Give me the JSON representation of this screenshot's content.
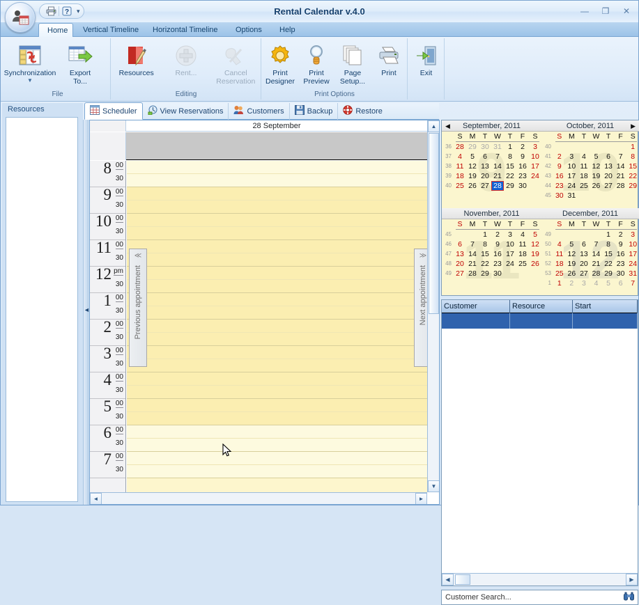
{
  "window": {
    "title": "Rental Calendar v.4.0",
    "minimize": "—",
    "maximize": "❐",
    "close": "✕"
  },
  "quick_access": {
    "print_tooltip": "Print",
    "help_tooltip": "Help",
    "dropdown": "▾"
  },
  "ribbon": {
    "tabs": [
      {
        "label": "Home",
        "active": true
      },
      {
        "label": "Vertical Timeline",
        "active": false
      },
      {
        "label": "Horizontal Timeline",
        "active": false
      },
      {
        "label": "Options",
        "active": false
      },
      {
        "label": "Help",
        "active": false
      }
    ],
    "groups": [
      {
        "name": "File",
        "label": "File",
        "items": [
          {
            "label": "Synchronization",
            "icon": "synchronization-icon",
            "dropdown": true,
            "disabled": false
          },
          {
            "label": "Export\nTo...",
            "icon": "export-icon",
            "dropdown": true,
            "disabled": false
          }
        ]
      },
      {
        "name": "Editing",
        "label": "Editing",
        "items": [
          {
            "label": "Resources",
            "icon": "resources-icon",
            "dropdown": false,
            "disabled": false
          },
          {
            "label": "Rent...",
            "icon": "plus-icon",
            "dropdown": false,
            "disabled": true
          },
          {
            "label": "Cancel\nReservation",
            "icon": "cancel-icon",
            "dropdown": true,
            "disabled": true
          }
        ]
      },
      {
        "name": "PrintOptions",
        "label": "Print Options",
        "items": [
          {
            "label": "Print\nDesigner",
            "icon": "gear-icon",
            "dropdown": false,
            "disabled": false
          },
          {
            "label": "Print\nPreview",
            "icon": "magnifier-icon",
            "dropdown": false,
            "disabled": false
          },
          {
            "label": "Page\nSetup...",
            "icon": "pages-icon",
            "dropdown": false,
            "disabled": false
          },
          {
            "label": "Print",
            "icon": "printer-icon",
            "dropdown": false,
            "disabled": false
          }
        ]
      },
      {
        "name": "Exit",
        "label": "",
        "items": [
          {
            "label": "Exit",
            "icon": "exit-door-icon",
            "dropdown": false,
            "disabled": false
          }
        ]
      }
    ]
  },
  "doctabs": [
    {
      "label": "Scheduler",
      "icon": "scheduler-grid-icon",
      "active": true
    },
    {
      "label": "View Reservations",
      "icon": "reservations-icon",
      "active": false
    },
    {
      "label": "Customers",
      "icon": "customers-icon",
      "active": false
    },
    {
      "label": "Backup",
      "icon": "backup-disk-icon",
      "active": false
    },
    {
      "label": "Restore",
      "icon": "restore-lifering-icon",
      "active": false
    }
  ],
  "resources_pane": {
    "caption": "Resources",
    "items": []
  },
  "scheduler": {
    "day_title": "28 September",
    "prev_appointment": "Previous appointment",
    "next_appointment": "Next appointment",
    "prev_chevron": "≪",
    "next_chevron": "≫",
    "hours": [
      {
        "hour": "8",
        "m0": "00",
        "m30": "30"
      },
      {
        "hour": "9",
        "m0": "00",
        "m30": "30"
      },
      {
        "hour": "10",
        "m0": "00",
        "m30": "30"
      },
      {
        "hour": "11",
        "m0": "00",
        "m30": "30"
      },
      {
        "hour": "12",
        "m0": "pm",
        "m30": "30"
      },
      {
        "hour": "1",
        "m0": "00",
        "m30": "30"
      },
      {
        "hour": "2",
        "m0": "00",
        "m30": "30"
      },
      {
        "hour": "3",
        "m0": "00",
        "m30": "30"
      },
      {
        "hour": "4",
        "m0": "00",
        "m30": "30"
      },
      {
        "hour": "5",
        "m0": "00",
        "m30": "30"
      },
      {
        "hour": "6",
        "m0": "00",
        "m30": "30"
      },
      {
        "hour": "7",
        "m0": "00",
        "m30": "30"
      }
    ]
  },
  "calendars": [
    {
      "caption": "September, 2011",
      "watermark": "9",
      "watermark_color": "#78785a",
      "nav": "prev",
      "nav_glyph": "◀",
      "dow": [
        "S",
        "M",
        "T",
        "W",
        "T",
        "F",
        "S"
      ],
      "weeks": [
        {
          "no": "36",
          "days": [
            {
              "t": "28",
              "c": "red"
            },
            {
              "t": "29",
              "c": "grey"
            },
            {
              "t": "30",
              "c": "grey"
            },
            {
              "t": "31",
              "c": "grey"
            },
            {
              "t": "1",
              "c": ""
            },
            {
              "t": "2",
              "c": ""
            },
            {
              "t": "3",
              "c": "red"
            }
          ]
        },
        {
          "no": "37",
          "days": [
            {
              "t": "4",
              "c": "red"
            },
            {
              "t": "5",
              "c": ""
            },
            {
              "t": "6",
              "c": ""
            },
            {
              "t": "7",
              "c": ""
            },
            {
              "t": "8",
              "c": ""
            },
            {
              "t": "9",
              "c": ""
            },
            {
              "t": "10",
              "c": "red"
            }
          ]
        },
        {
          "no": "38",
          "days": [
            {
              "t": "11",
              "c": "red"
            },
            {
              "t": "12",
              "c": ""
            },
            {
              "t": "13",
              "c": ""
            },
            {
              "t": "14",
              "c": ""
            },
            {
              "t": "15",
              "c": ""
            },
            {
              "t": "16",
              "c": ""
            },
            {
              "t": "17",
              "c": "red"
            }
          ]
        },
        {
          "no": "39",
          "days": [
            {
              "t": "18",
              "c": "red"
            },
            {
              "t": "19",
              "c": ""
            },
            {
              "t": "20",
              "c": ""
            },
            {
              "t": "21",
              "c": ""
            },
            {
              "t": "22",
              "c": ""
            },
            {
              "t": "23",
              "c": ""
            },
            {
              "t": "24",
              "c": "red"
            }
          ]
        },
        {
          "no": "40",
          "days": [
            {
              "t": "25",
              "c": "red"
            },
            {
              "t": "26",
              "c": ""
            },
            {
              "t": "27",
              "c": ""
            },
            {
              "t": "28",
              "c": "sel"
            },
            {
              "t": "29",
              "c": ""
            },
            {
              "t": "30",
              "c": ""
            },
            {
              "t": "",
              "c": ""
            }
          ]
        }
      ]
    },
    {
      "caption": "October, 2011",
      "watermark": "10",
      "watermark_color": "#78785a",
      "nav": "next",
      "nav_glyph": "▶",
      "dow": [
        "S",
        "M",
        "T",
        "W",
        "T",
        "F",
        "S"
      ],
      "weeks": [
        {
          "no": "40",
          "days": [
            {
              "t": "",
              "c": ""
            },
            {
              "t": "",
              "c": ""
            },
            {
              "t": "",
              "c": ""
            },
            {
              "t": "",
              "c": ""
            },
            {
              "t": "",
              "c": ""
            },
            {
              "t": "",
              "c": ""
            },
            {
              "t": "1",
              "c": "red"
            }
          ]
        },
        {
          "no": "41",
          "days": [
            {
              "t": "2",
              "c": "red"
            },
            {
              "t": "3",
              "c": ""
            },
            {
              "t": "4",
              "c": ""
            },
            {
              "t": "5",
              "c": ""
            },
            {
              "t": "6",
              "c": ""
            },
            {
              "t": "7",
              "c": ""
            },
            {
              "t": "8",
              "c": "red"
            }
          ]
        },
        {
          "no": "42",
          "days": [
            {
              "t": "9",
              "c": "red"
            },
            {
              "t": "10",
              "c": ""
            },
            {
              "t": "11",
              "c": ""
            },
            {
              "t": "12",
              "c": ""
            },
            {
              "t": "13",
              "c": ""
            },
            {
              "t": "14",
              "c": ""
            },
            {
              "t": "15",
              "c": "red"
            }
          ]
        },
        {
          "no": "43",
          "days": [
            {
              "t": "16",
              "c": "red"
            },
            {
              "t": "17",
              "c": ""
            },
            {
              "t": "18",
              "c": ""
            },
            {
              "t": "19",
              "c": ""
            },
            {
              "t": "20",
              "c": ""
            },
            {
              "t": "21",
              "c": ""
            },
            {
              "t": "22",
              "c": "red"
            }
          ]
        },
        {
          "no": "44",
          "days": [
            {
              "t": "23",
              "c": "red"
            },
            {
              "t": "24",
              "c": ""
            },
            {
              "t": "25",
              "c": ""
            },
            {
              "t": "26",
              "c": ""
            },
            {
              "t": "27",
              "c": ""
            },
            {
              "t": "28",
              "c": ""
            },
            {
              "t": "29",
              "c": "red"
            }
          ]
        },
        {
          "no": "45",
          "days": [
            {
              "t": "30",
              "c": "red"
            },
            {
              "t": "31",
              "c": ""
            },
            {
              "t": "",
              "c": ""
            },
            {
              "t": "",
              "c": ""
            },
            {
              "t": "",
              "c": ""
            },
            {
              "t": "",
              "c": ""
            },
            {
              "t": "",
              "c": ""
            }
          ]
        }
      ]
    },
    {
      "caption": "November, 2011",
      "watermark": "11",
      "watermark_color": "#78785a",
      "nav": "",
      "nav_glyph": "",
      "dow": [
        "S",
        "M",
        "T",
        "W",
        "T",
        "F",
        "S"
      ],
      "weeks": [
        {
          "no": "45",
          "days": [
            {
              "t": "",
              "c": ""
            },
            {
              "t": "",
              "c": ""
            },
            {
              "t": "1",
              "c": ""
            },
            {
              "t": "2",
              "c": ""
            },
            {
              "t": "3",
              "c": ""
            },
            {
              "t": "4",
              "c": ""
            },
            {
              "t": "5",
              "c": "red"
            }
          ]
        },
        {
          "no": "46",
          "days": [
            {
              "t": "6",
              "c": "red"
            },
            {
              "t": "7",
              "c": ""
            },
            {
              "t": "8",
              "c": ""
            },
            {
              "t": "9",
              "c": ""
            },
            {
              "t": "10",
              "c": ""
            },
            {
              "t": "11",
              "c": ""
            },
            {
              "t": "12",
              "c": "red"
            }
          ]
        },
        {
          "no": "47",
          "days": [
            {
              "t": "13",
              "c": "red"
            },
            {
              "t": "14",
              "c": ""
            },
            {
              "t": "15",
              "c": ""
            },
            {
              "t": "16",
              "c": ""
            },
            {
              "t": "17",
              "c": ""
            },
            {
              "t": "18",
              "c": ""
            },
            {
              "t": "19",
              "c": "red"
            }
          ]
        },
        {
          "no": "48",
          "days": [
            {
              "t": "20",
              "c": "red"
            },
            {
              "t": "21",
              "c": ""
            },
            {
              "t": "22",
              "c": ""
            },
            {
              "t": "23",
              "c": ""
            },
            {
              "t": "24",
              "c": ""
            },
            {
              "t": "25",
              "c": ""
            },
            {
              "t": "26",
              "c": "red"
            }
          ]
        },
        {
          "no": "49",
          "days": [
            {
              "t": "27",
              "c": "red"
            },
            {
              "t": "28",
              "c": ""
            },
            {
              "t": "29",
              "c": ""
            },
            {
              "t": "30",
              "c": ""
            },
            {
              "t": "",
              "c": ""
            },
            {
              "t": "",
              "c": ""
            },
            {
              "t": "",
              "c": ""
            }
          ]
        }
      ]
    },
    {
      "caption": "December, 2011",
      "watermark": "12",
      "watermark_color": "#5a6482",
      "nav": "",
      "nav_glyph": "",
      "dow": [
        "S",
        "M",
        "T",
        "W",
        "T",
        "F",
        "S"
      ],
      "weeks": [
        {
          "no": "49",
          "days": [
            {
              "t": "",
              "c": ""
            },
            {
              "t": "",
              "c": ""
            },
            {
              "t": "",
              "c": ""
            },
            {
              "t": "",
              "c": ""
            },
            {
              "t": "1",
              "c": ""
            },
            {
              "t": "2",
              "c": ""
            },
            {
              "t": "3",
              "c": "red"
            }
          ]
        },
        {
          "no": "50",
          "days": [
            {
              "t": "4",
              "c": "red"
            },
            {
              "t": "5",
              "c": ""
            },
            {
              "t": "6",
              "c": ""
            },
            {
              "t": "7",
              "c": ""
            },
            {
              "t": "8",
              "c": ""
            },
            {
              "t": "9",
              "c": ""
            },
            {
              "t": "10",
              "c": "red"
            }
          ]
        },
        {
          "no": "51",
          "days": [
            {
              "t": "11",
              "c": "red"
            },
            {
              "t": "12",
              "c": ""
            },
            {
              "t": "13",
              "c": ""
            },
            {
              "t": "14",
              "c": ""
            },
            {
              "t": "15",
              "c": ""
            },
            {
              "t": "16",
              "c": ""
            },
            {
              "t": "17",
              "c": "red"
            }
          ]
        },
        {
          "no": "52",
          "days": [
            {
              "t": "18",
              "c": "red"
            },
            {
              "t": "19",
              "c": ""
            },
            {
              "t": "20",
              "c": ""
            },
            {
              "t": "21",
              "c": ""
            },
            {
              "t": "22",
              "c": ""
            },
            {
              "t": "23",
              "c": ""
            },
            {
              "t": "24",
              "c": "red"
            }
          ]
        },
        {
          "no": "53",
          "days": [
            {
              "t": "25",
              "c": "red"
            },
            {
              "t": "26",
              "c": ""
            },
            {
              "t": "27",
              "c": ""
            },
            {
              "t": "28",
              "c": ""
            },
            {
              "t": "29",
              "c": ""
            },
            {
              "t": "30",
              "c": ""
            },
            {
              "t": "31",
              "c": "red"
            }
          ]
        },
        {
          "no": "1",
          "days": [
            {
              "t": "1",
              "c": "red"
            },
            {
              "t": "2",
              "c": "grey"
            },
            {
              "t": "3",
              "c": "grey"
            },
            {
              "t": "4",
              "c": "grey"
            },
            {
              "t": "5",
              "c": "grey"
            },
            {
              "t": "6",
              "c": "grey"
            },
            {
              "t": "7",
              "c": "red"
            }
          ]
        }
      ]
    }
  ],
  "reservation_grid": {
    "columns": [
      "Customer",
      "Resource",
      "Start"
    ],
    "rows": [
      {
        "customer": "",
        "resource": "",
        "start": ""
      }
    ],
    "scroll_prev": "◀",
    "scroll_next": "▶"
  },
  "search": {
    "placeholder": "Customer Search...",
    "icon": "binoculars-icon"
  },
  "colors": {
    "accent": "#1263d4",
    "scheduler_work": "#fbeeb1",
    "scheduler_off": "#fdfadf",
    "selection": "#2f62ad",
    "weekend": "#c00000"
  }
}
